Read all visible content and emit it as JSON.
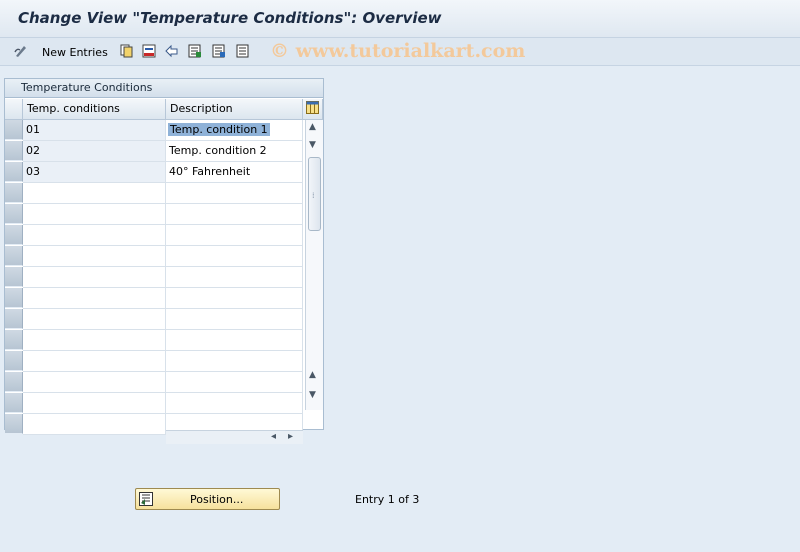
{
  "window": {
    "title": "Change View \"Temperature Conditions\": Overview"
  },
  "toolbar": {
    "new_entries_label": "New Entries",
    "watermark": "© www.tutorialkart.com"
  },
  "table": {
    "title": "Temperature Conditions",
    "columns": [
      "Temp. conditions",
      "Description"
    ],
    "rows": [
      {
        "code": "01",
        "description": "Temp. condition 1"
      },
      {
        "code": "02",
        "description": "Temp. condition 2"
      },
      {
        "code": "03",
        "description": "40° Fahrenheit"
      }
    ]
  },
  "footer": {
    "position_button_label": "Position...",
    "entry_info": "Entry 1 of 3"
  },
  "colors": {
    "accent": "#f6e19d",
    "background": "#e3ecf5",
    "selection": "#8fb2d8"
  }
}
